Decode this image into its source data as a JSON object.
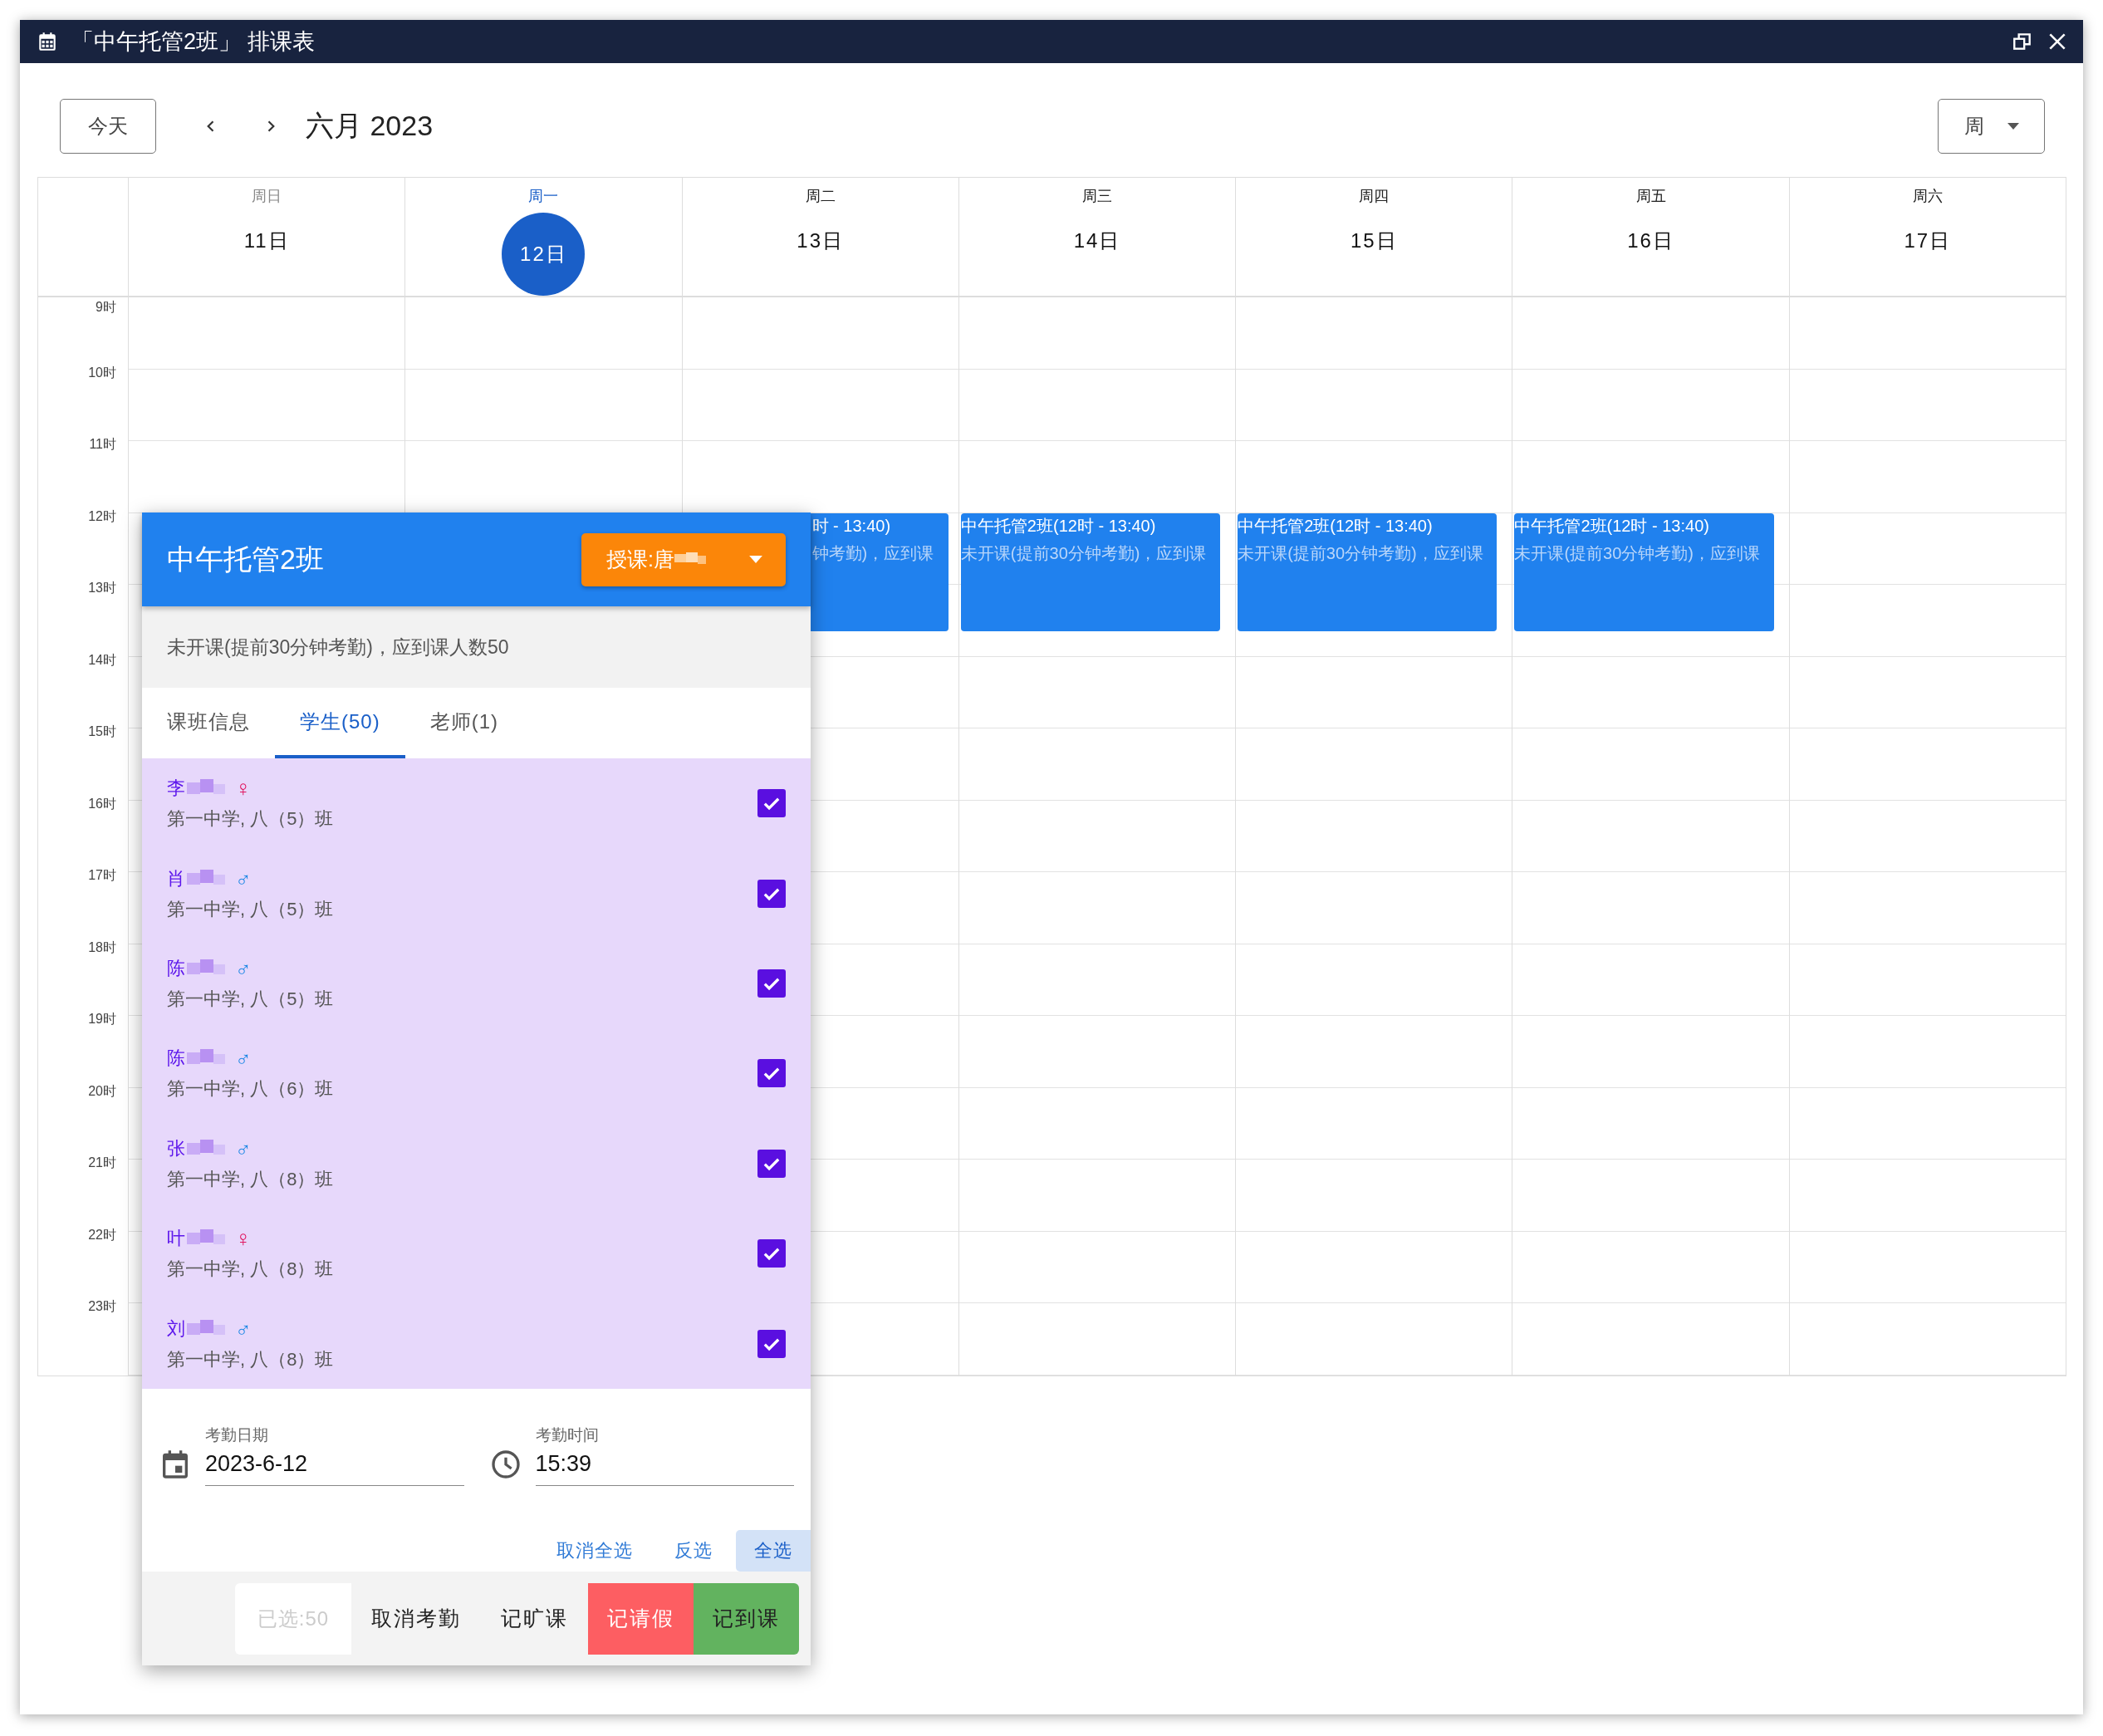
{
  "window": {
    "title": "「中午托管2班」 排课表"
  },
  "toolbar": {
    "today_button": "今天",
    "month": "六月 2023",
    "view_select": "周"
  },
  "days": [
    {
      "weekday": "周日",
      "date": "11日",
      "kind": "past"
    },
    {
      "weekday": "周一",
      "date": "12日",
      "kind": "current"
    },
    {
      "weekday": "周二",
      "date": "13日",
      "kind": "future",
      "events": [
        {
          "kind": "partial",
          "title": "时 - 13:40)",
          "detail": "钟考勤)，应到课"
        }
      ]
    },
    {
      "weekday": "周三",
      "date": "14日",
      "kind": "future",
      "events": [
        {
          "kind": "full",
          "title": "中午托管2班(12时 - 13:40)",
          "detail": "未开课(提前30分钟考勤)，应到课"
        }
      ]
    },
    {
      "weekday": "周四",
      "date": "15日",
      "kind": "future",
      "events": [
        {
          "kind": "full",
          "title": "中午托管2班(12时 - 13:40)",
          "detail": "未开课(提前30分钟考勤)，应到课"
        }
      ]
    },
    {
      "weekday": "周五",
      "date": "16日",
      "kind": "future",
      "events": [
        {
          "kind": "full",
          "title": "中午托管2班(12时 - 13:40)",
          "detail": "未开课(提前30分钟考勤)，应到课"
        }
      ]
    },
    {
      "weekday": "周六",
      "date": "17日",
      "kind": "future"
    }
  ],
  "hours": [
    "9时",
    "10时",
    "11时",
    "12时",
    "13时",
    "14时",
    "15时",
    "16时",
    "17时",
    "18时",
    "19时",
    "20时",
    "21时",
    "22时",
    "23时"
  ],
  "popup": {
    "title": "中午托管2班",
    "teacher_button": "授课:唐",
    "status": "未开课(提前30分钟考勤)，应到课人数50",
    "tabs": [
      {
        "label": "课班信息",
        "selected": false
      },
      {
        "label": "学生(50)",
        "selected": true
      },
      {
        "label": "老师(1)",
        "selected": false
      }
    ],
    "students": [
      {
        "name": "李",
        "gender_symbol": "♀",
        "color": "#e0125c",
        "school": "第一中学, 八（5）班",
        "checked": true
      },
      {
        "name": "肖",
        "gender_symbol": "♂",
        "color": "#1e88e5",
        "school": "第一中学, 八（5）班",
        "checked": true
      },
      {
        "name": "陈",
        "gender_symbol": "♂",
        "color": "#1e88e5",
        "school": "第一中学, 八（5）班",
        "checked": true
      },
      {
        "name": "陈",
        "gender_symbol": "♂",
        "color": "#1e88e5",
        "school": "第一中学, 八（6）班",
        "checked": true
      },
      {
        "name": "张",
        "gender_symbol": "♂",
        "color": "#1e88e5",
        "school": "第一中学, 八（8）班",
        "checked": true
      },
      {
        "name": "叶",
        "gender_symbol": "♀",
        "color": "#e0125c",
        "school": "第一中学, 八（8）班",
        "checked": true
      },
      {
        "name": "刘",
        "gender_symbol": "♂",
        "color": "#1e88e5",
        "school": "第一中学, 八（8）班",
        "checked": true
      }
    ],
    "date_field": {
      "label": "考勤日期",
      "value": "2023-6-12"
    },
    "time_field": {
      "label": "考勤时间",
      "value": "15:39"
    },
    "selection_links": [
      {
        "label": "取消全选",
        "selected": false
      },
      {
        "label": "反选",
        "selected": false
      },
      {
        "label": "全选",
        "selected": true
      }
    ],
    "selected_count": "已选:50",
    "actions": [
      {
        "label": "取消考勤",
        "kind": "plain"
      },
      {
        "label": "记旷课",
        "kind": "plain"
      },
      {
        "label": "记请假",
        "kind": "leave"
      },
      {
        "label": "记到课",
        "kind": "present"
      }
    ]
  }
}
